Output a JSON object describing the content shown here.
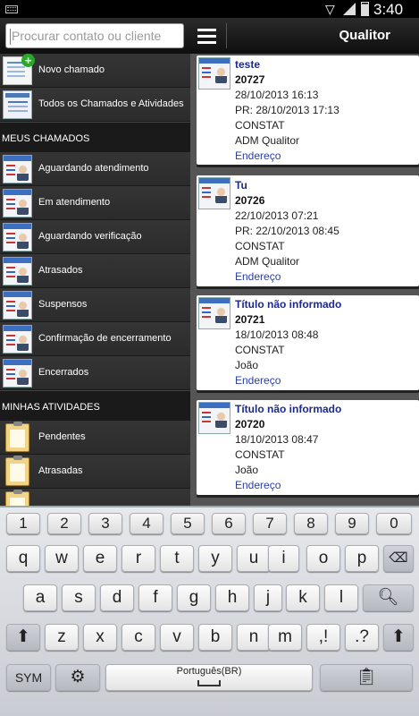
{
  "status_bar": {
    "time": "3:40 PM"
  },
  "action_bar": {
    "search_placeholder": "Procurar contato ou cliente",
    "title": "Qualitor"
  },
  "left_menu": {
    "top_items": [
      {
        "label": "Novo chamado",
        "icon": "new-ticket-icon"
      },
      {
        "label": "Todos os Chamados e Atividades",
        "icon": "all-tickets-icon"
      }
    ],
    "sections": [
      {
        "header": "MEUS CHAMADOS",
        "items": [
          {
            "label": "Aguardando atendimento",
            "icon": "ticket-person-icon"
          },
          {
            "label": "Em atendimento",
            "icon": "ticket-person-icon"
          },
          {
            "label": "Aguardando verificação",
            "icon": "ticket-person-icon"
          },
          {
            "label": "Atrasados",
            "icon": "ticket-person-icon"
          },
          {
            "label": "Suspensos",
            "icon": "ticket-person-icon"
          },
          {
            "label": "Confirmação de encerramento",
            "icon": "ticket-person-icon"
          },
          {
            "label": "Encerrados",
            "icon": "ticket-person-icon"
          }
        ]
      },
      {
        "header": "MINHAS ATIVIDADES",
        "items": [
          {
            "label": "Pendentes",
            "icon": "clipboard-icon"
          },
          {
            "label": "Atrasadas",
            "icon": "clipboard-icon"
          },
          {
            "label": "",
            "icon": "clipboard-icon"
          }
        ]
      }
    ]
  },
  "tickets": [
    {
      "title": "teste",
      "number": "20727",
      "opened": "28/10/2013 16:13",
      "due": "PR: 28/10/2013 17:13",
      "client": "CONSTAT",
      "company": "ADM Qualitor",
      "link": "Endereço"
    },
    {
      "title": "Tu",
      "number": "20726",
      "opened": "22/10/2013 07:21",
      "due": "PR: 22/10/2013 08:45",
      "client": "CONSTAT",
      "company": "ADM Qualitor",
      "link": "Endereço"
    },
    {
      "title": "Título não informado",
      "number": "20721",
      "opened": "18/10/2013 08:48",
      "client": "CONSTAT",
      "company": "João",
      "link": "Endereço"
    },
    {
      "title": "Título não informado",
      "number": "20720",
      "opened": "18/10/2013 08:47",
      "client": "CONSTAT",
      "company": "João",
      "link": "Endereço"
    }
  ],
  "keyboard": {
    "row_numbers": [
      "1",
      "2",
      "3",
      "4",
      "5",
      "6",
      "7",
      "8",
      "9",
      "0"
    ],
    "row1": [
      "q",
      "w",
      "e",
      "r",
      "t",
      "y",
      "u",
      "i",
      "o",
      "p"
    ],
    "row2": [
      "a",
      "s",
      "d",
      "f",
      "g",
      "h",
      "j",
      "k",
      "l"
    ],
    "row3": [
      "z",
      "x",
      "c",
      "v",
      "b",
      "n",
      "m",
      ",!",
      ".?"
    ],
    "sym_label": "SYM",
    "space_label": "Português(BR)"
  }
}
